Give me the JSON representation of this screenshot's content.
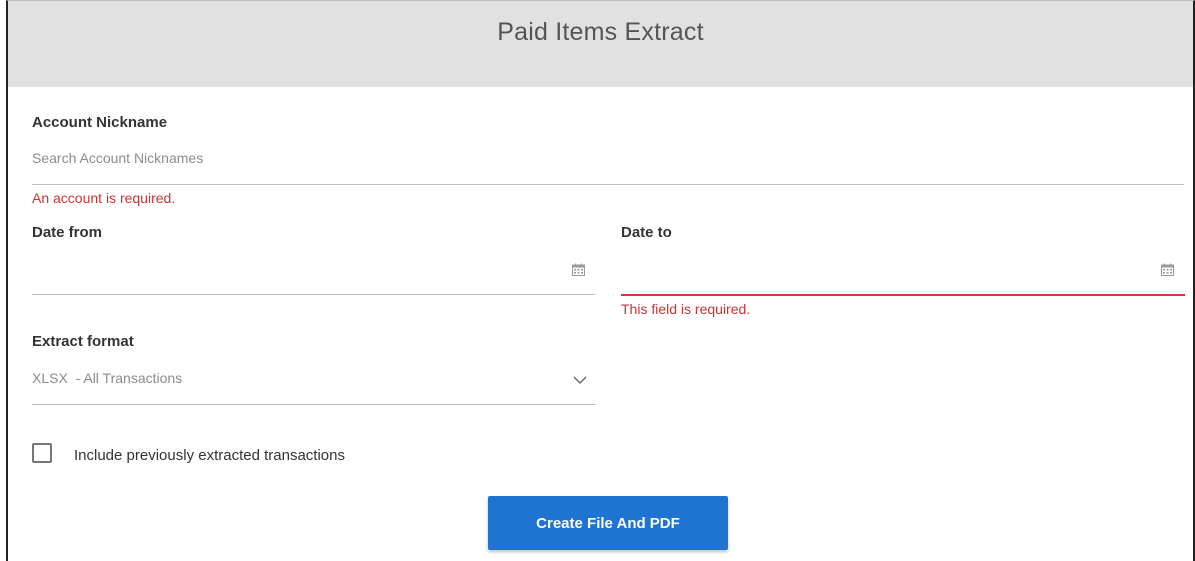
{
  "header": {
    "title": "Paid Items Extract"
  },
  "account_nickname": {
    "label": "Account Nickname",
    "placeholder": "Search Account Nicknames",
    "error": "An account is required."
  },
  "date_from": {
    "label": "Date from",
    "value": "",
    "icon": "calendar-icon"
  },
  "date_to": {
    "label": "Date to",
    "value": "",
    "icon": "calendar-icon",
    "error": "This field is required."
  },
  "extract_format": {
    "label": "Extract format",
    "selected": "XLSX  - All Transactions",
    "icon": "chevron-down-icon"
  },
  "include_previous": {
    "label": "Include previously extracted transactions",
    "checked": false
  },
  "submit": {
    "label": "Create File And PDF"
  },
  "colors": {
    "header_bg": "#e1e1e1",
    "error": "#c93434",
    "primary_button": "#1f73d1"
  }
}
